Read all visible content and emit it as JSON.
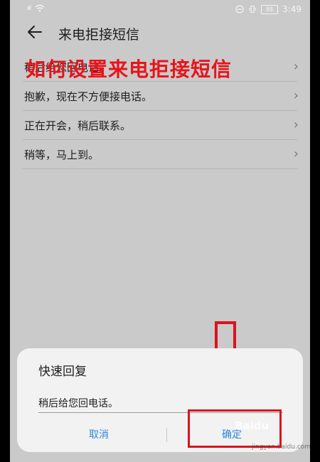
{
  "status_bar": {
    "signal": "ııl",
    "battery_level": "88",
    "time": "3:49"
  },
  "header": {
    "title": "来电拒接短信"
  },
  "overlay_caption": "如何设置来电拒接短信",
  "messages": [
    {
      "text": "稍后给您回电话。"
    },
    {
      "text": "抱歉，现在不方便接电话。"
    },
    {
      "text": "正在开会，稍后联系。"
    },
    {
      "text": "稍等，马上到。"
    }
  ],
  "dialog": {
    "title": "快速回复",
    "input_value": "稍后给您回电话。",
    "cancel_label": "取消",
    "confirm_label": "确定"
  },
  "watermark": {
    "main": "Baidu",
    "sub": "jingyan.baidu.com"
  },
  "colors": {
    "accent": "#2a87d8",
    "highlight_red": "#d9141c",
    "screen_bg": "#cacaca"
  }
}
